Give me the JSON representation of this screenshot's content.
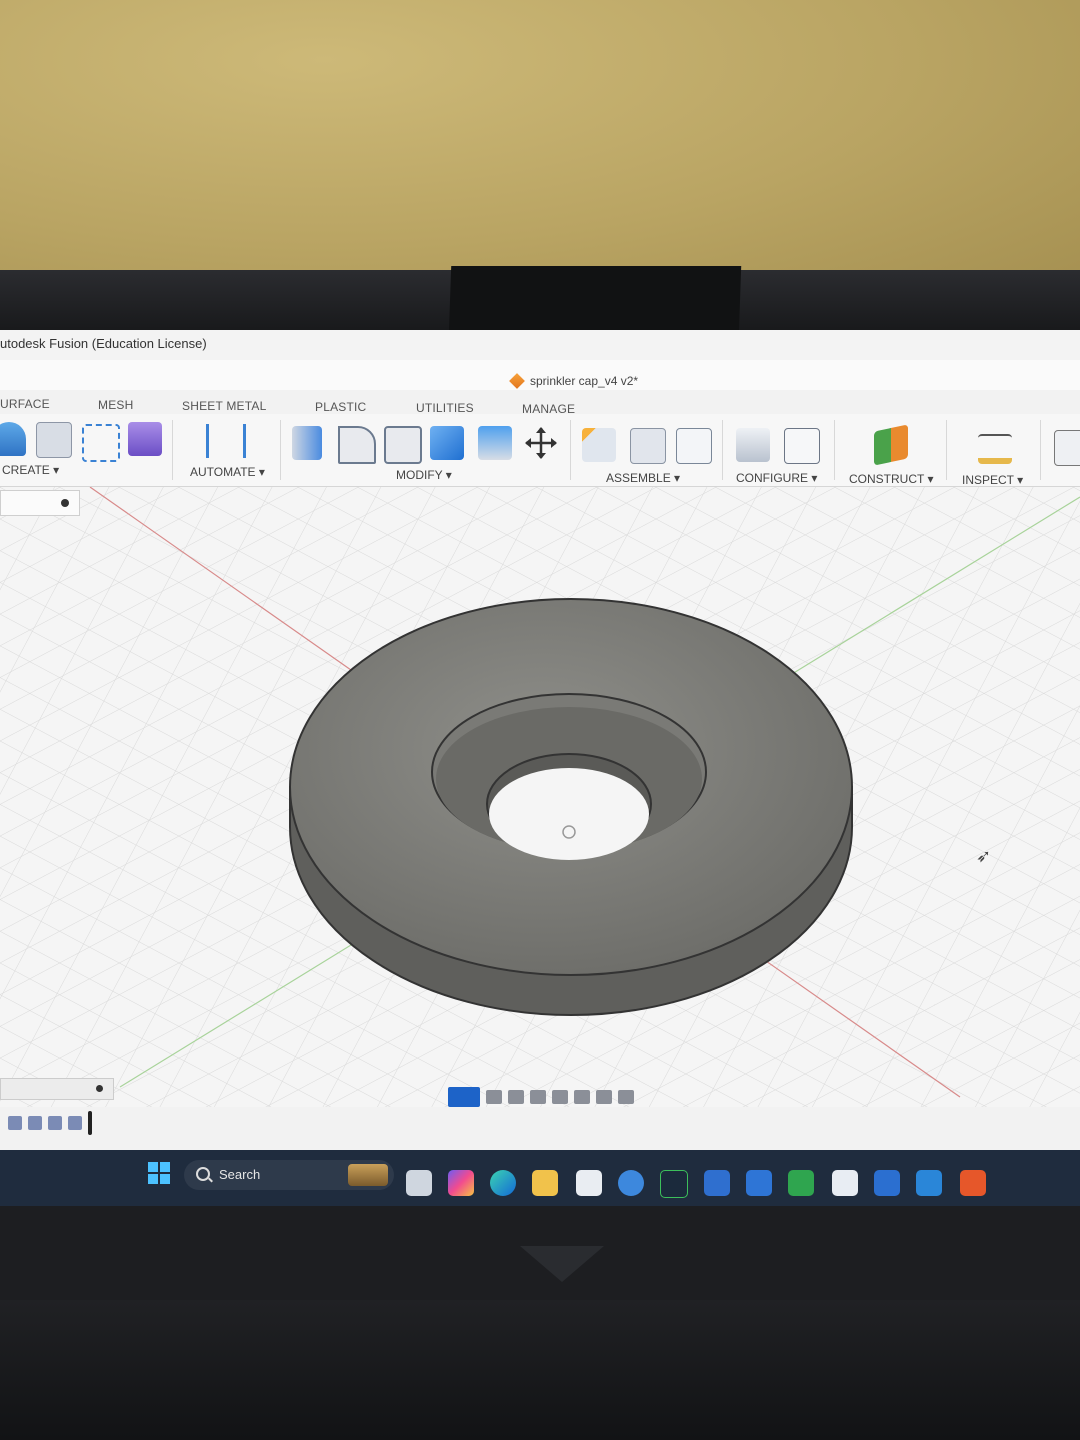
{
  "window": {
    "title": "utodesk Fusion (Education License)"
  },
  "document": {
    "name": "sprinkler cap_v4 v2*"
  },
  "tabs": [
    "URFACE",
    "MESH",
    "SHEET METAL",
    "PLASTIC",
    "UTILITIES",
    "MANAGE"
  ],
  "toolbar": {
    "create_label": "CREATE ▾",
    "automate_label": "AUTOMATE ▾",
    "modify_label": "MODIFY ▾",
    "assemble_label": "ASSEMBLE ▾",
    "configure_label": "CONFIGURE ▾",
    "construct_label": "CONSTRUCT ▾",
    "inspect_label": "INSPECT ▾"
  },
  "taskbar": {
    "search_label": "Search"
  },
  "colors": {
    "accent": "#1d63c8",
    "toolbar_bg": "#f7f7f7",
    "taskbar_bg": "#1f2c3e"
  }
}
